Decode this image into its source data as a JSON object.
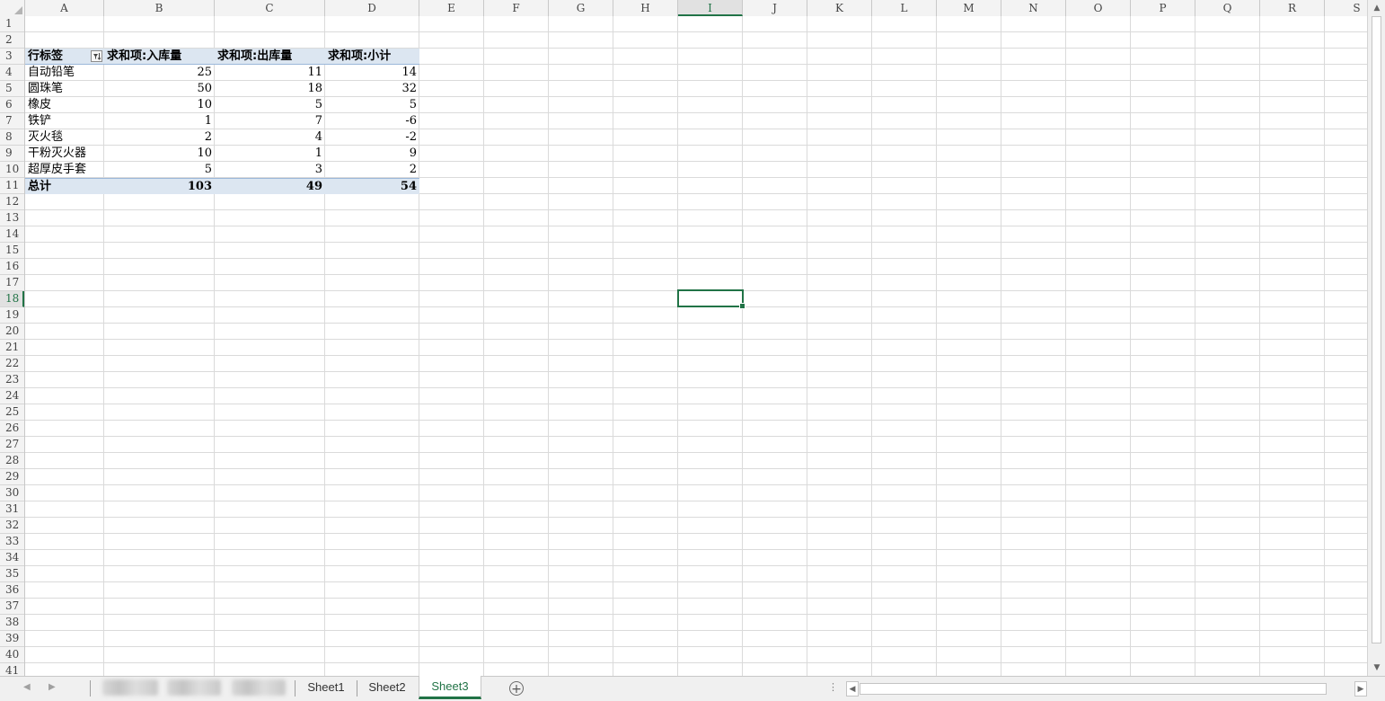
{
  "columns": [
    "A",
    "B",
    "C",
    "D",
    "E",
    "F",
    "G",
    "H",
    "I",
    "J",
    "K",
    "L",
    "M",
    "N",
    "O",
    "P",
    "Q",
    "R",
    "S"
  ],
  "rows": [
    "1",
    "2",
    "3",
    "4",
    "5",
    "6",
    "7",
    "8",
    "9",
    "10",
    "11",
    "12",
    "13",
    "14",
    "15",
    "16",
    "17",
    "18",
    "19",
    "20",
    "21",
    "22",
    "23",
    "24",
    "25",
    "26",
    "27",
    "28",
    "29",
    "30",
    "31",
    "32",
    "33",
    "34",
    "35",
    "36",
    "37",
    "38",
    "39",
    "40",
    "41"
  ],
  "selected": {
    "column": "I",
    "row": "18"
  },
  "pivot": {
    "headers": [
      "行标签",
      "求和项:入库量",
      "求和项:出库量",
      "求和项:小计"
    ],
    "rows": [
      {
        "label": "自动铅笔",
        "in": "25",
        "out": "11",
        "sub": "14"
      },
      {
        "label": "圆珠笔",
        "in": "50",
        "out": "18",
        "sub": "32"
      },
      {
        "label": "橡皮",
        "in": "10",
        "out": "5",
        "sub": "5"
      },
      {
        "label": "铁铲",
        "in": "1",
        "out": "7",
        "sub": "-6"
      },
      {
        "label": "灭火毯",
        "in": "2",
        "out": "4",
        "sub": "-2"
      },
      {
        "label": "干粉灭火器",
        "in": "10",
        "out": "1",
        "sub": "9"
      },
      {
        "label": "超厚皮手套",
        "in": "5",
        "out": "3",
        "sub": "2"
      }
    ],
    "total": {
      "label": "总计",
      "in": "103",
      "out": "49",
      "sub": "54"
    }
  },
  "tabs": {
    "sheets": [
      "Sheet1",
      "Sheet2",
      "Sheet3"
    ],
    "active": "Sheet3"
  },
  "colors": {
    "accent": "#217346",
    "pivot_header": "#dce6f1"
  }
}
